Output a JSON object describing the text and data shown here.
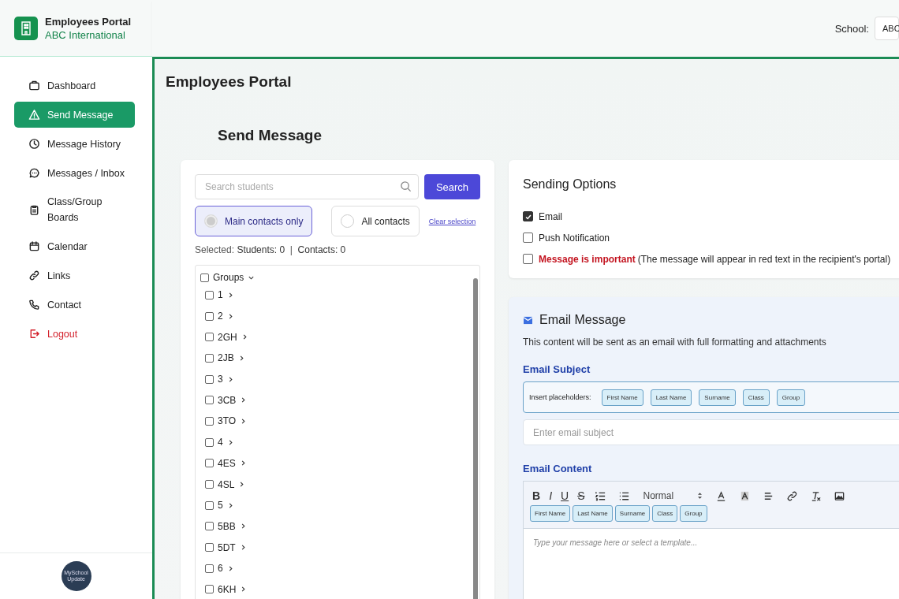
{
  "brand": {
    "title": "Employees Portal",
    "subtitle": "ABC International"
  },
  "header": {
    "school_label": "School:",
    "school_value": "ABC"
  },
  "sidebar": {
    "items": [
      {
        "label": "Dashboard",
        "selected": false,
        "kind": "nav"
      },
      {
        "label": "Send Message",
        "selected": true,
        "kind": "nav"
      },
      {
        "label": "Message History",
        "selected": false,
        "kind": "nav"
      },
      {
        "label": "Messages / Inbox",
        "selected": false,
        "kind": "nav"
      },
      {
        "label": "Class/Group Boards",
        "selected": false,
        "kind": "nav"
      },
      {
        "label": "Calendar",
        "selected": false,
        "kind": "nav"
      },
      {
        "label": "Links",
        "selected": false,
        "kind": "nav"
      },
      {
        "label": "Contact",
        "selected": false,
        "kind": "nav"
      },
      {
        "label": "Logout",
        "selected": false,
        "kind": "danger"
      }
    ],
    "footer_logo": "MySchool Update"
  },
  "page_title": "Employees Portal",
  "section_title": "Send Message",
  "recipients": {
    "search_placeholder": "Search students",
    "search_button": "Search",
    "options": [
      {
        "label": "Main contacts only",
        "selected": true
      },
      {
        "label": "All contacts",
        "selected": false
      }
    ],
    "clear_link": "Clear selection",
    "summary": "Selected: **Students: 0**  |  **Contacts: 0**",
    "tree": {
      "label": "Groups",
      "checked": false,
      "children": [
        {
          "label": "1",
          "checked": false
        },
        {
          "label": "2",
          "checked": false
        },
        {
          "label": "2GH",
          "checked": false
        },
        {
          "label": "2JB",
          "checked": false
        },
        {
          "label": "3",
          "checked": false
        },
        {
          "label": "3CB",
          "checked": false
        },
        {
          "label": "3TO",
          "checked": false
        },
        {
          "label": "4",
          "checked": false
        },
        {
          "label": "4ES",
          "checked": false
        },
        {
          "label": "4SL",
          "checked": false
        },
        {
          "label": "5",
          "checked": false
        },
        {
          "label": "5BB",
          "checked": false
        },
        {
          "label": "5DT",
          "checked": false
        },
        {
          "label": "6",
          "checked": false
        },
        {
          "label": "6KH",
          "checked": false
        }
      ]
    }
  },
  "sending_options": {
    "title": "Sending Options",
    "options": [
      {
        "label": "Email",
        "checked": true,
        "important": false
      },
      {
        "label": "Push Notification",
        "checked": false,
        "important": false
      },
      {
        "label": "Message is important",
        "note": "(The message will appear in red text in the recipient's portal)",
        "checked": false,
        "important": true
      }
    ]
  },
  "email": {
    "title": "Email Message",
    "description": "This content will be sent as an email with full formatting and attachments",
    "subject_label": "Email Subject",
    "placeholders_label": "Insert placeholders:",
    "placeholders": [
      "First Name",
      "Last Name",
      "Surname",
      "Class",
      "Group"
    ],
    "subject_placeholder": "Enter email subject",
    "content_label": "Email Content",
    "toolbar": [
      {
        "kind": "text",
        "label": "B"
      },
      {
        "kind": "text",
        "label": "I"
      },
      {
        "kind": "text",
        "label": "U"
      },
      {
        "kind": "text",
        "label": "S"
      },
      {
        "kind": "ordered"
      },
      {
        "kind": "bullet"
      },
      {
        "kind": "select",
        "label": "Normal"
      },
      {
        "kind": "color"
      },
      {
        "kind": "background"
      },
      {
        "kind": "align"
      },
      {
        "kind": "link"
      },
      {
        "kind": "clear"
      },
      {
        "kind": "image"
      }
    ],
    "content_placeholders": [
      "First Name",
      "Last Name",
      "Surname",
      "Class",
      "Group"
    ],
    "content_placeholder": "Type your message here or select a template..."
  }
}
